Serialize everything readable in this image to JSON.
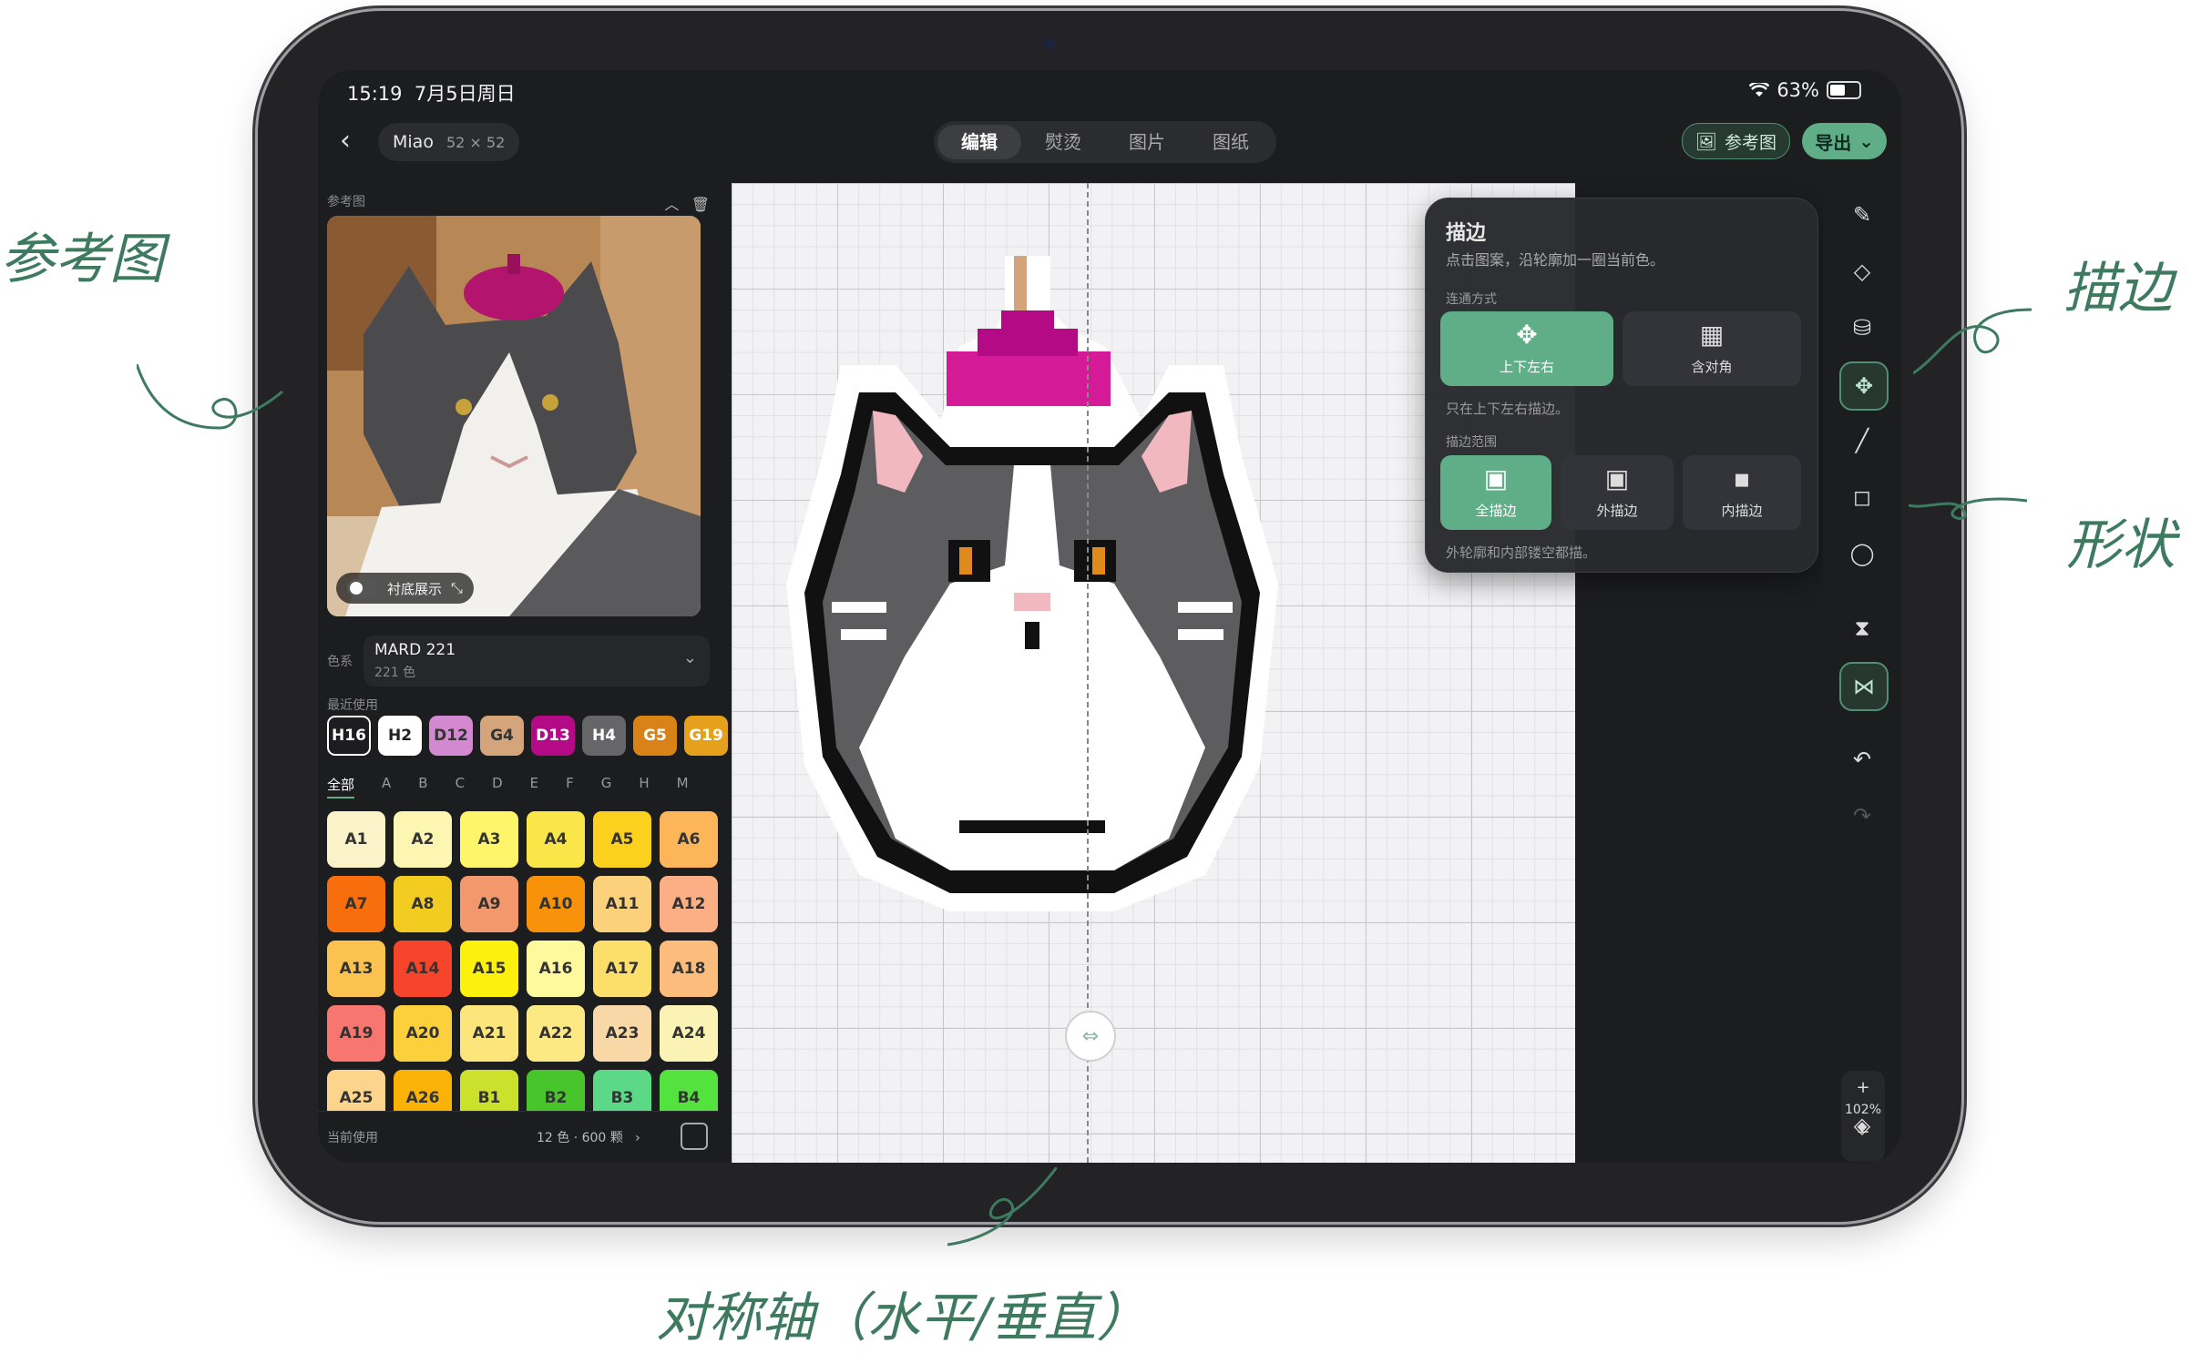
{
  "status": {
    "time": "15:19",
    "date": "7月5日周日",
    "battery": "63%",
    "battery_level": 0.63
  },
  "header": {
    "back_icon": "chevron-left-icon",
    "project_name": "Miao",
    "grid_w": "52",
    "grid_x": "×",
    "grid_h": "52",
    "tabs": [
      "编辑",
      "熨烫",
      "图片",
      "图纸"
    ],
    "active_tab": 0,
    "reference_button": "参考图",
    "export_button": "导出"
  },
  "left": {
    "reference_label": "参考图",
    "toggle_label": "衬底展示",
    "color_system_label": "色系",
    "color_system_name": "MARD 221",
    "color_system_count": "221 色",
    "recent_label": "最近使用",
    "recent": [
      {
        "code": "H16",
        "bg": "#1d1d1f",
        "fg": "#ffffff",
        "border": "#ffffff"
      },
      {
        "code": "H2",
        "bg": "#ffffff",
        "fg": "#222222"
      },
      {
        "code": "D12",
        "bg": "#d389cf",
        "fg": "#333333"
      },
      {
        "code": "G4",
        "bg": "#d4a57a",
        "fg": "#333333"
      },
      {
        "code": "D13",
        "bg": "#b40a86",
        "fg": "#ffffff"
      },
      {
        "code": "H4",
        "bg": "#666668",
        "fg": "#ffffff"
      },
      {
        "code": "G5",
        "bg": "#d98218",
        "fg": "#ffffff"
      },
      {
        "code": "G19",
        "bg": "#e5a11c",
        "fg": "#ffffff"
      }
    ],
    "letters": [
      "全部",
      "A",
      "B",
      "C",
      "D",
      "E",
      "F",
      "G",
      "H",
      "M"
    ],
    "palette": [
      {
        "code": "A1",
        "bg": "#fcf2c9"
      },
      {
        "code": "A2",
        "bg": "#fdf6b3"
      },
      {
        "code": "A3",
        "bg": "#fef56a"
      },
      {
        "code": "A4",
        "bg": "#fbe64a"
      },
      {
        "code": "A5",
        "bg": "#fbd11e"
      },
      {
        "code": "A6",
        "bg": "#fdb55a"
      },
      {
        "code": "A7",
        "bg": "#f86d0c"
      },
      {
        "code": "A8",
        "bg": "#f3cc21"
      },
      {
        "code": "A9",
        "bg": "#f2986c"
      },
      {
        "code": "A10",
        "bg": "#f7920a"
      },
      {
        "code": "A11",
        "bg": "#fcd17c"
      },
      {
        "code": "A12",
        "bg": "#fcae84"
      },
      {
        "code": "A13",
        "bg": "#fcc24f"
      },
      {
        "code": "A14",
        "bg": "#f7452b"
      },
      {
        "code": "A15",
        "bg": "#fbf10c"
      },
      {
        "code": "A16",
        "bg": "#fef99c"
      },
      {
        "code": "A17",
        "bg": "#fcdf6b"
      },
      {
        "code": "A18",
        "bg": "#fcbc7c"
      },
      {
        "code": "A19",
        "bg": "#f87670"
      },
      {
        "code": "A20",
        "bg": "#fbd03c"
      },
      {
        "code": "A21",
        "bg": "#fce57a"
      },
      {
        "code": "A22",
        "bg": "#fde984"
      },
      {
        "code": "A23",
        "bg": "#f9d8a8"
      },
      {
        "code": "A24",
        "bg": "#fbf3b5"
      },
      {
        "code": "A25",
        "bg": "#fcd48b"
      },
      {
        "code": "A26",
        "bg": "#fbb207"
      },
      {
        "code": "B1",
        "bg": "#cbe12b"
      },
      {
        "code": "B2",
        "bg": "#47c52a"
      },
      {
        "code": "B3",
        "bg": "#5bd986"
      },
      {
        "code": "B4",
        "bg": "#54e33e"
      }
    ],
    "bottom_label": "当前使用",
    "bottom_count": "12 色 · 600 颗"
  },
  "popup": {
    "title": "描边",
    "subtitle": "点击图案，沿轮廓加一圈当前色。",
    "connect_label": "连通方式",
    "connect_options": [
      "上下左右",
      "含对角"
    ],
    "connect_hint": "只在上下左右描边。",
    "range_label": "描边范围",
    "range_options": [
      "全描边",
      "外描边",
      "内描边"
    ],
    "range_hint": "外轮廓和内部镂空都描。"
  },
  "toolbar": {
    "tools": [
      "pen-icon",
      "eraser-icon",
      "bucket-icon",
      "outline-icon",
      "line-icon",
      "shape-icon",
      "lasso-icon",
      "symmetry-horizontal-icon",
      "symmetry-vertical-icon",
      "undo-icon",
      "redo-icon"
    ],
    "zoom_plus": "+",
    "zoom": "102%",
    "zoom_minus": "−",
    "layers_icon": "layers-icon"
  },
  "annotations": {
    "reference": "参考图",
    "outline": "描边",
    "shape": "形状",
    "symmetry": "对称轴（水平/垂直）"
  },
  "colors": {
    "accent": "#5fae88",
    "annotation": "#3d7a60"
  }
}
